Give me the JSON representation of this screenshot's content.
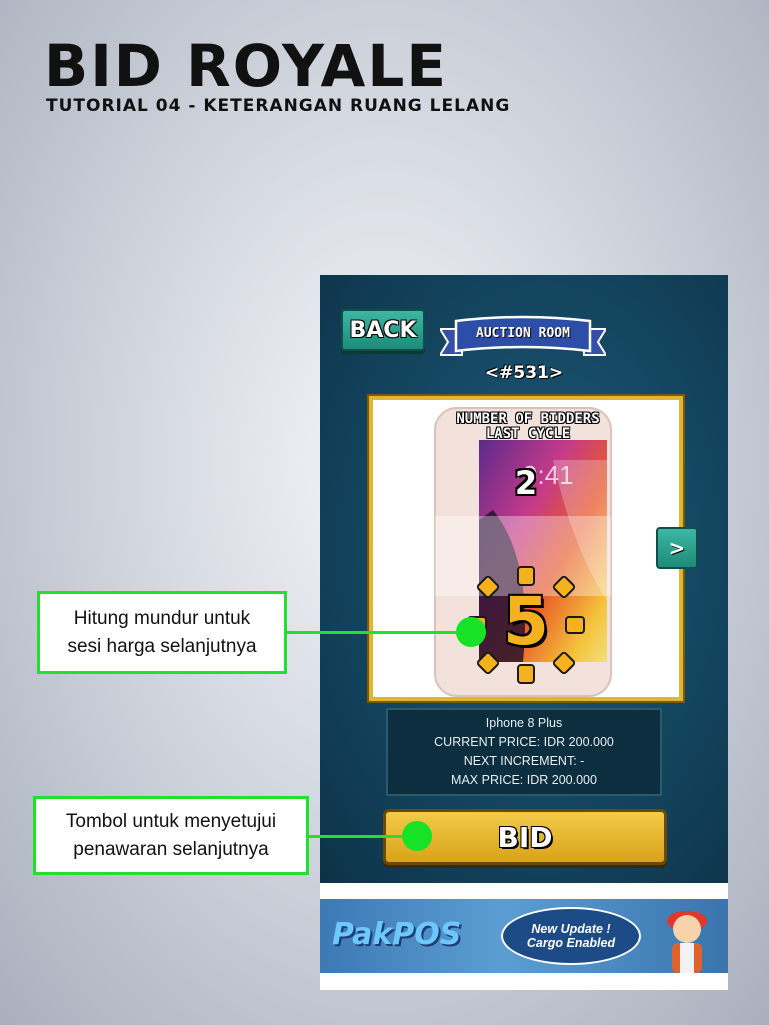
{
  "header": {
    "title": "BID ROYALE",
    "subtitle": "TUTORIAL 04 - KETERANGAN RUANG LELANG"
  },
  "app": {
    "back_label": "BACK",
    "room_banner": "AUCTION ROOM",
    "room_id": "<#531>",
    "bidders_label_line1": "NUMBER OF BIDDERS",
    "bidders_label_line2": "LAST CYCLE",
    "bidders_count": "2",
    "countdown": "5",
    "next_label": ">",
    "phone_time": "9:41",
    "product": {
      "name": "Iphone 8 Plus",
      "current_price": "CURRENT PRICE: IDR 200.000",
      "next_increment": "NEXT INCREMENT: -",
      "max_price": "MAX PRICE: IDR 200.000"
    },
    "bid_label": "BID"
  },
  "ad": {
    "logo_text": "PakPOS",
    "bubble_line1": "New Update !",
    "bubble_line2": "Cargo Enabled"
  },
  "callouts": {
    "countdown": [
      "Hitung mundur untuk",
      "sesi harga selanjutnya"
    ],
    "bid_button": [
      "Tombol untuk menyetujui",
      "penawaran selanjutnya"
    ]
  },
  "colors": {
    "callout_green": "#22e02e",
    "gold": "#e0b532",
    "teal": "#2aa592",
    "app_bg": "#113f58"
  }
}
